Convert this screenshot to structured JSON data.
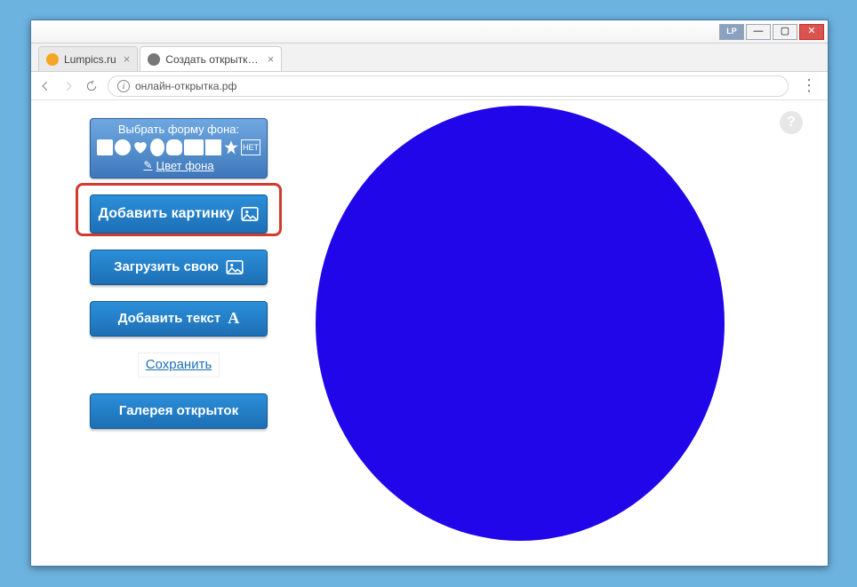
{
  "browser": {
    "tabs": [
      {
        "label": "Lumpics.ru",
        "active": false
      },
      {
        "label": "Создать открытку онлай",
        "active": true
      }
    ],
    "url": "онлайн-открытка.рф",
    "window_buttons": {
      "lp": "LP",
      "min": "—",
      "max": "▢",
      "close": "✕"
    }
  },
  "panel": {
    "shape_title": "Выбрать форму фона:",
    "shape_none": "НЕТ",
    "color_link": "Цвет фона",
    "add_image": "Добавить картинку",
    "upload_own": "Загрузить свою",
    "add_text": "Добавить текст",
    "save": "Сохранить",
    "gallery": "Галерея открыток"
  },
  "canvas": {
    "shape": "ellipse",
    "fill": "#2006e9"
  },
  "help": "?"
}
